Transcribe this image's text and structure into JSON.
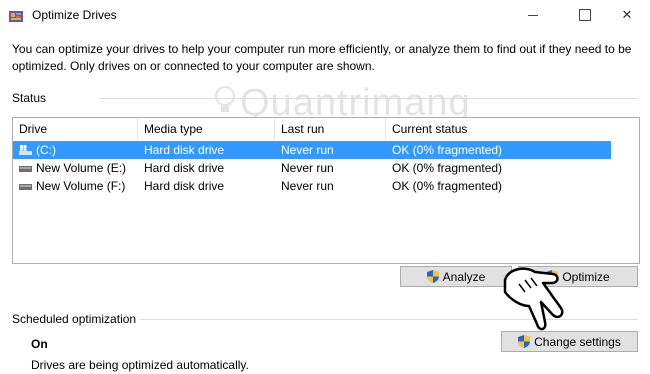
{
  "window": {
    "title": "Optimize Drives"
  },
  "description": "You can optimize your drives to help your computer run more efficiently, or analyze them to find out if they need to be optimized. Only drives on or connected to your computer are shown.",
  "status": {
    "label": "Status",
    "columns": [
      "Drive",
      "Media type",
      "Last run",
      "Current status"
    ],
    "rows": [
      {
        "drive": "(C:)",
        "media_type": "Hard disk drive",
        "last_run": "Never run",
        "current_status": "OK (0% fragmented)",
        "icon": "windows-drive-icon",
        "selected": true
      },
      {
        "drive": "New Volume (E:)",
        "media_type": "Hard disk drive",
        "last_run": "Never run",
        "current_status": "OK (0% fragmented)",
        "icon": "hard-drive-icon",
        "selected": false
      },
      {
        "drive": "New Volume (F:)",
        "media_type": "Hard disk drive",
        "last_run": "Never run",
        "current_status": "OK (0% fragmented)",
        "icon": "hard-drive-icon",
        "selected": false
      }
    ]
  },
  "buttons": {
    "analyze": "Analyze",
    "optimize": "Optimize",
    "change_settings": "Change settings"
  },
  "scheduled": {
    "label": "Scheduled optimization",
    "state": "On",
    "detail": "Drives are being optimized automatically."
  },
  "watermark": "Quantrimang",
  "colors": {
    "selection": "#3399ff",
    "button_bg": "#e1e1e1",
    "border": "#adadad"
  }
}
